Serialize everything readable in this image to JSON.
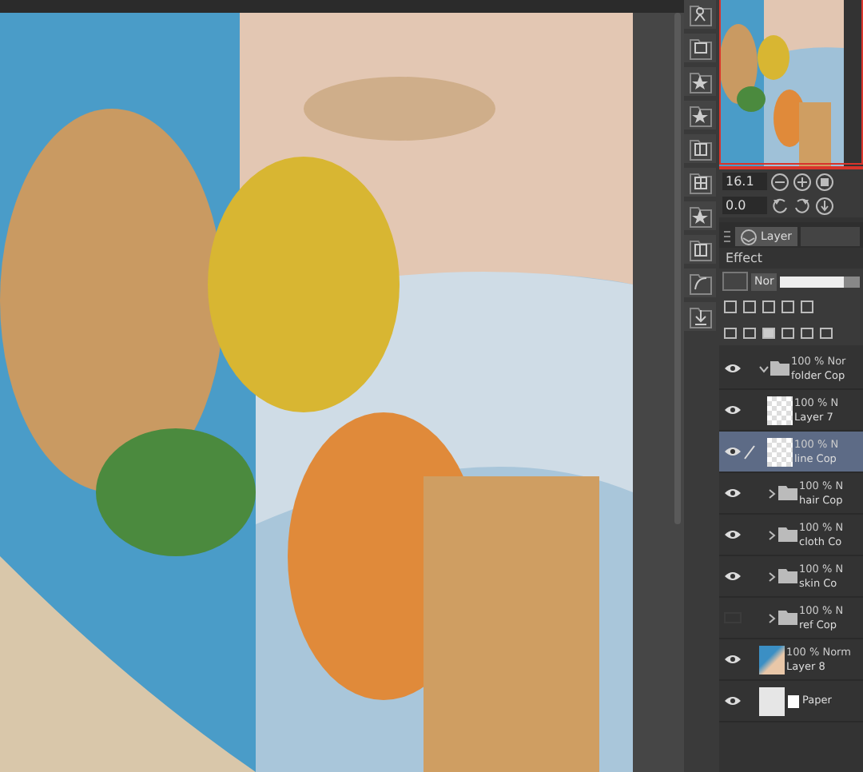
{
  "navigator": {
    "zoom": "16.1",
    "rotation": "0.0"
  },
  "panel_tabs": [
    {
      "label": "Layer",
      "selected": true
    }
  ],
  "effect_label": "Effect",
  "blend_mode": "Nor",
  "opacity": {
    "level": 0.8
  },
  "layers": [
    {
      "kind": "folder",
      "mode": "100 % Nor",
      "name": "folder Cop",
      "visible": true,
      "selected": false,
      "expanded": true,
      "children": [
        {
          "kind": "raster",
          "mode": "100 % N",
          "name": "Layer 7",
          "visible": true,
          "selected": false
        },
        {
          "kind": "raster",
          "mode": "100 % N",
          "name": "line Cop",
          "visible": true,
          "selected": true
        },
        {
          "kind": "folder",
          "mode": "100 % N",
          "name": "hair Cop",
          "visible": true,
          "selected": false,
          "expanded": false
        },
        {
          "kind": "folder",
          "mode": "100 % N",
          "name": "cloth Co",
          "visible": true,
          "selected": false,
          "expanded": false
        },
        {
          "kind": "folder",
          "mode": "100 % N",
          "name": "skin Co",
          "visible": true,
          "selected": false,
          "expanded": false
        },
        {
          "kind": "folder",
          "mode": "100 % N",
          "name": "ref Cop",
          "visible": false,
          "selected": false,
          "expanded": false
        }
      ]
    },
    {
      "mode": "100 % Norm",
      "name": "Layer 8",
      "visible": true,
      "selected": false
    },
    {
      "kind": "paper",
      "name": "Paper",
      "visible": true,
      "selected": false
    }
  ]
}
